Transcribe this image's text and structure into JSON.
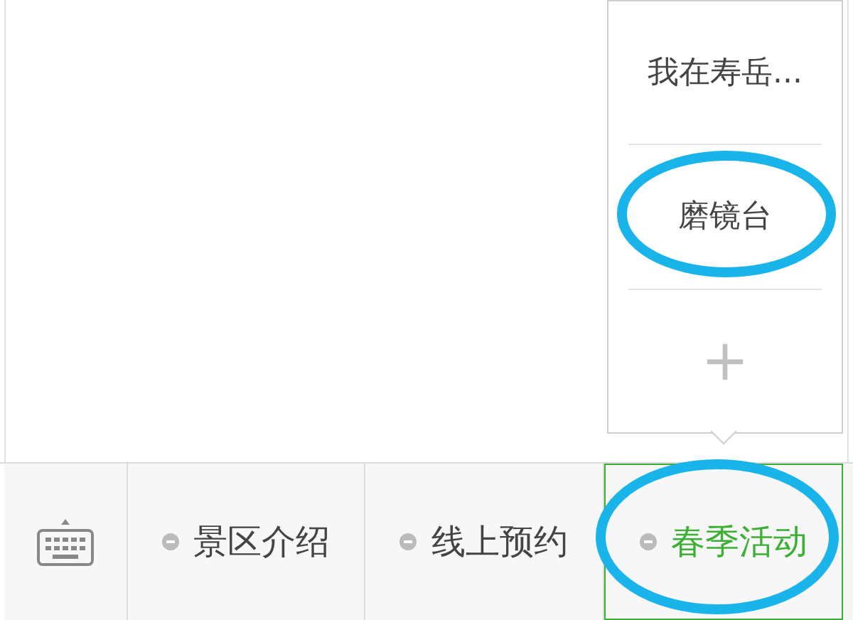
{
  "submenu": {
    "items": [
      {
        "kind": "text",
        "label": "我在寿岳...",
        "circled": false
      },
      {
        "kind": "text",
        "label": "磨镜台",
        "circled": true
      },
      {
        "kind": "add",
        "label": "+",
        "circled": false
      }
    ]
  },
  "menu_bar": {
    "items": [
      {
        "label": "景区介绍",
        "selected": false,
        "circled": false
      },
      {
        "label": "线上预约",
        "selected": false,
        "circled": false
      },
      {
        "label": "春季活动",
        "selected": true,
        "circled": true
      }
    ]
  }
}
